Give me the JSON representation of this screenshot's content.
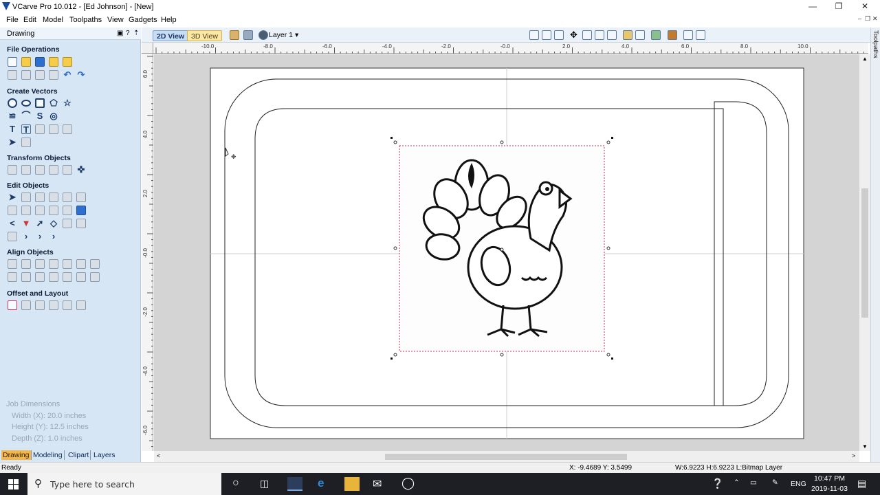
{
  "window": {
    "title": "VCarve Pro 10.012 - [Ed Johnson] - [New]"
  },
  "menu": [
    "File",
    "Edit",
    "Model",
    "Toolpaths",
    "View",
    "Gadgets",
    "Help"
  ],
  "panel": {
    "title": "Drawing",
    "sections": {
      "file_ops": "File Operations",
      "create_vectors": "Create Vectors",
      "transform": "Transform Objects",
      "edit": "Edit Objects",
      "align": "Align Objects",
      "offset": "Offset and Layout"
    },
    "job": {
      "heading": "Job Dimensions",
      "width": "Width  (X): 20.0 inches",
      "height": "Height (Y): 12.5 inches",
      "depth": "Depth  (Z): 1.0 inches"
    },
    "tabs": [
      "Drawing",
      "Modeling",
      "Clipart",
      "Layers"
    ]
  },
  "toolbar": {
    "view2d": "2D View",
    "view3d": "3D View",
    "layer": "Layer 1"
  },
  "ruler": {
    "top": [
      "-10.0",
      "-8.0",
      "-6.0",
      "-4.0",
      "-2.0",
      "-0.0",
      "2.0",
      "4.0",
      "6.0",
      "8.0",
      "10.0"
    ],
    "left": [
      "6.0",
      "4.0",
      "2.0",
      "-0.0",
      "-2.0",
      "-4.0",
      "-6.0"
    ]
  },
  "right_tab": "Toolpaths",
  "status": {
    "ready": "Ready",
    "coords": "X: -9.4689 Y: 3.5499",
    "dims": "W:6.9223   H:6.9223   L:Bitmap Layer"
  },
  "taskbar": {
    "search_placeholder": "Type here to search",
    "lang": "ENG",
    "time": "10:47 PM",
    "date": "2019-11-03"
  },
  "colors": {
    "panel": "#d6e6f5",
    "active_tab": "#f3b749",
    "selection": "#c33355"
  }
}
